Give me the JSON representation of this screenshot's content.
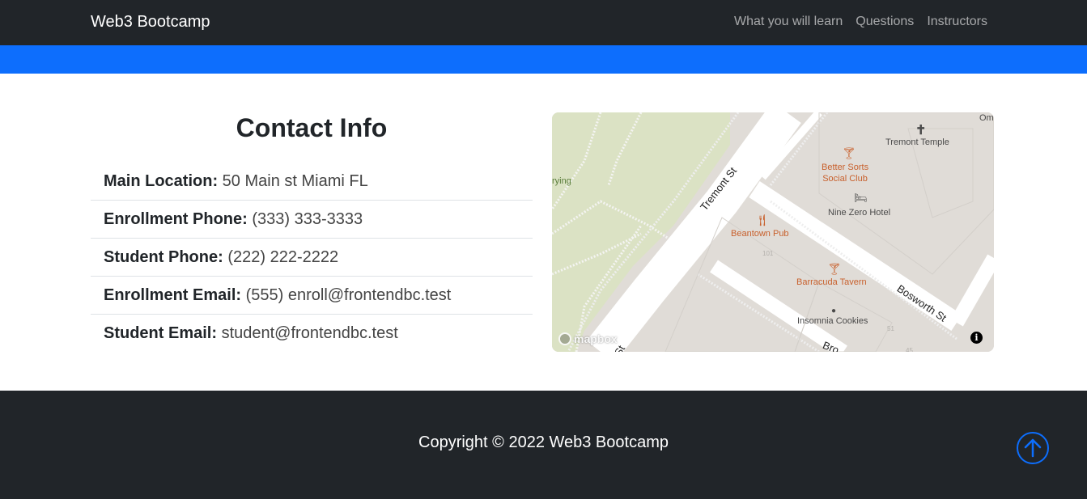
{
  "navbar": {
    "brand": "Web3 Bootcamp",
    "links": [
      {
        "label": "What you will learn"
      },
      {
        "label": "Questions"
      },
      {
        "label": "Instructors"
      }
    ]
  },
  "contact": {
    "title": "Contact Info",
    "items": [
      {
        "label": "Main Location:",
        "value": "50 Main st Miami FL"
      },
      {
        "label": "Enrollment Phone:",
        "value": "(333) 333-3333"
      },
      {
        "label": "Student Phone:",
        "value": "(222) 222-2222"
      },
      {
        "label": "Enrollment Email:",
        "value": "(555) enroll@frontendbc.test"
      },
      {
        "label": "Student Email:",
        "value": "student@frontendbc.test"
      }
    ]
  },
  "map": {
    "pois": {
      "tremont_temple": "Tremont Temple",
      "better_sorts": "Better Sorts\nSocial Club",
      "nine_zero": "Nine Zero Hotel",
      "beantown_pub": "Beantown Pub",
      "barracuda": "Barracuda Tavern",
      "insomnia": "Insomnia Cookies",
      "partial_left": "rying",
      "partial_right": "Om"
    },
    "streets": {
      "tremont": "Tremont St",
      "bosworth": "Bosworth St",
      "bro": "Bro",
      "st": "St"
    },
    "numbers": {
      "n101": "101",
      "n51": "51",
      "n45": "45"
    },
    "attribution": "mapbox",
    "colors": {
      "park": "#dbe2c4",
      "road": "#ffffff",
      "block": "#e0dcd7",
      "poi_orange": "#c8602c"
    }
  },
  "footer": {
    "copyright": "Copyright © 2022 Web3 Bootcamp"
  },
  "colors": {
    "navbar_bg": "#212529",
    "accent": "#0d6efd",
    "footer_bg": "#212529"
  }
}
